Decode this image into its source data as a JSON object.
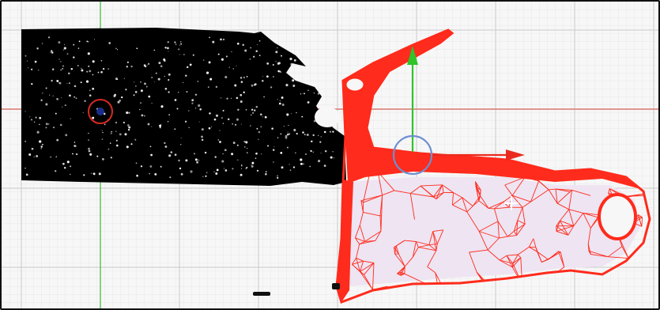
{
  "viewport": {
    "background": "#f7f7f7",
    "minor_grid_color": "#e3e3e3",
    "major_grid_color": "#c9c9c9",
    "x_axis_color": "#d9776f",
    "y_axis_color": "#4fc34f"
  },
  "objects": {
    "black_point_cloud": {
      "color": "#000000",
      "state": "unselected"
    },
    "red_mesh": {
      "color": "#ff2b1c",
      "fill": "#eee4f2",
      "state": "selected"
    }
  },
  "pivot_marker": {
    "icon": "pivot-ring-icon",
    "ring_color": "#d72a22",
    "dot_color": "#1b2d8a"
  },
  "gizmo": {
    "x_arrow_color": "#ea2a1f",
    "y_arrow_color": "#2ec42a",
    "rotate_ring_color": "#6f8fd0"
  },
  "cursor": {
    "icon": "crosshair-cursor-icon"
  }
}
